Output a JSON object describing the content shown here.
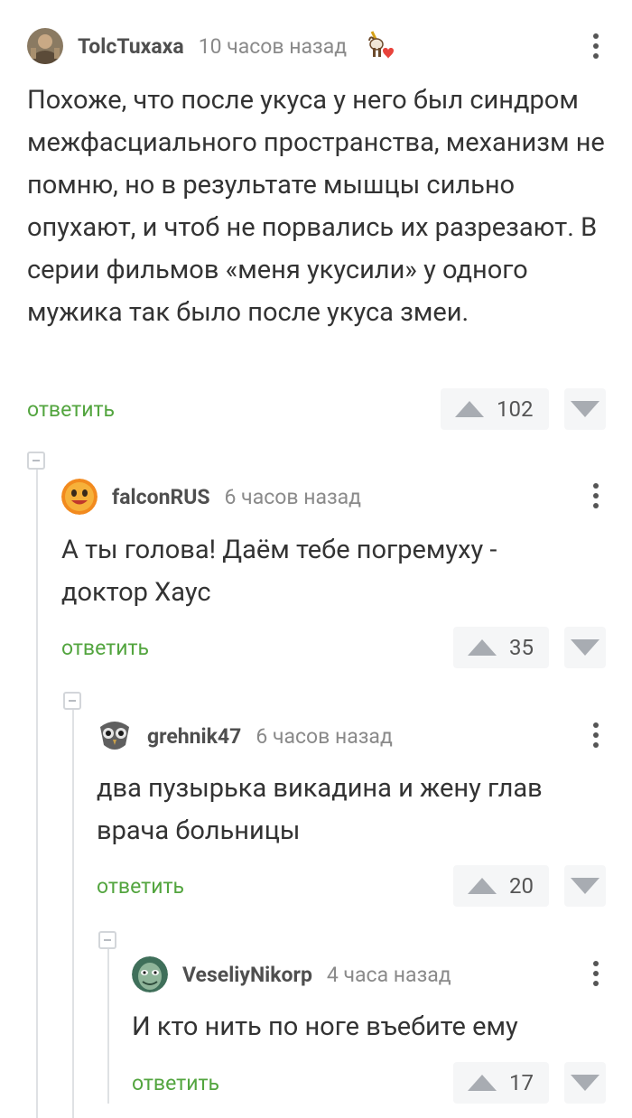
{
  "comments": [
    {
      "author": "TolcTuxaxa",
      "time": "10 часов назад",
      "text": "Похоже, что после укуса у него был синдром межфасциального пространства, механизм не помню, но в результате мышцы сильно опухают, и чтоб не порвались их разрезают. В серии фильмов «меня укусили» у одного мужика так было после укуса змеи.",
      "reply_label": "ответить",
      "rating": "102",
      "avatar_icon": "avatar-person-icon",
      "badge_icon": "unicorn-heart-badge-icon"
    },
    {
      "author": "falconRUS",
      "time": "6 часов назад",
      "text": "А ты голова! Даём тебе погремуху - доктор Хаус",
      "reply_label": "ответить",
      "rating": "35",
      "avatar_icon": "avatar-smiley-icon"
    },
    {
      "author": "grehnik47",
      "time": "6 часов назад",
      "text": "два пузырька викадина и жену глав врача больницы",
      "reply_label": "ответить",
      "rating": "20",
      "avatar_icon": "avatar-owl-icon"
    },
    {
      "author": "VeseliyNikorp",
      "time": "4 часа назад",
      "text": "И кто нить по ноге въебите ему",
      "reply_label": "ответить",
      "rating": "17",
      "avatar_icon": "avatar-face-icon"
    }
  ],
  "colors": {
    "reply_green": "#53a53f",
    "vote_bg": "#f5f6f7",
    "vote_icon": "#a8acb2",
    "thread_line": "#dfe1e4"
  }
}
